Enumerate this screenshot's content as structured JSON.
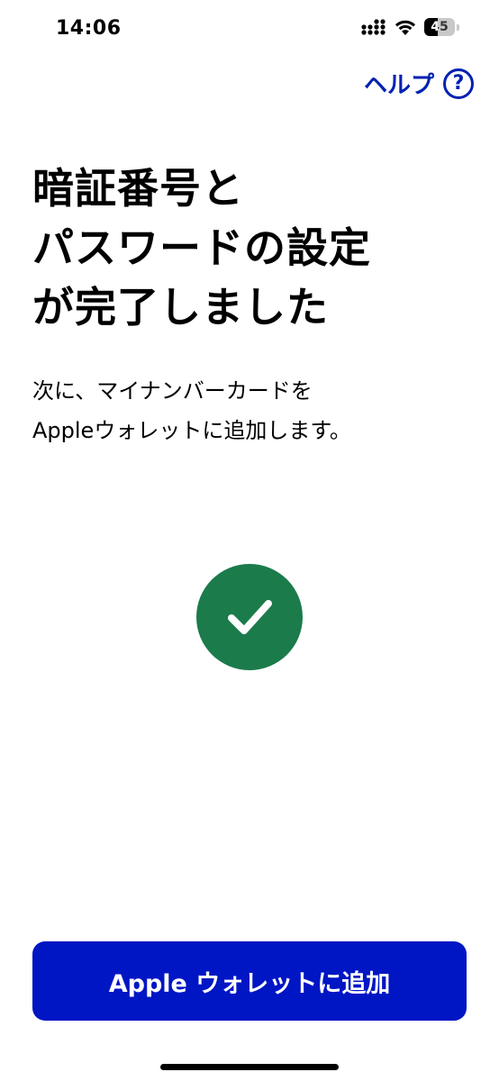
{
  "status_bar": {
    "time": "14:06",
    "battery_level": "45",
    "battery_percent": 45,
    "icons": [
      "signal-icon",
      "wifi-icon",
      "battery-icon"
    ]
  },
  "help": {
    "label": "ヘルプ",
    "icon_glyph": "?",
    "icon": "question-circle-icon"
  },
  "title_lines": [
    "暗証番号と",
    "パスワードの設定",
    "が完了しました"
  ],
  "description_lines": [
    "次に、マイナンバーカードを",
    "Appleウォレットに追加します。"
  ],
  "success_icon": "checkmark-circle-icon",
  "primary_button": {
    "label": "Apple ウォレットに追加"
  },
  "colors": {
    "accent": "#0021b3",
    "button_background": "#0016c4",
    "success": "#1b7b4b",
    "text": "#000000",
    "background": "#ffffff"
  }
}
